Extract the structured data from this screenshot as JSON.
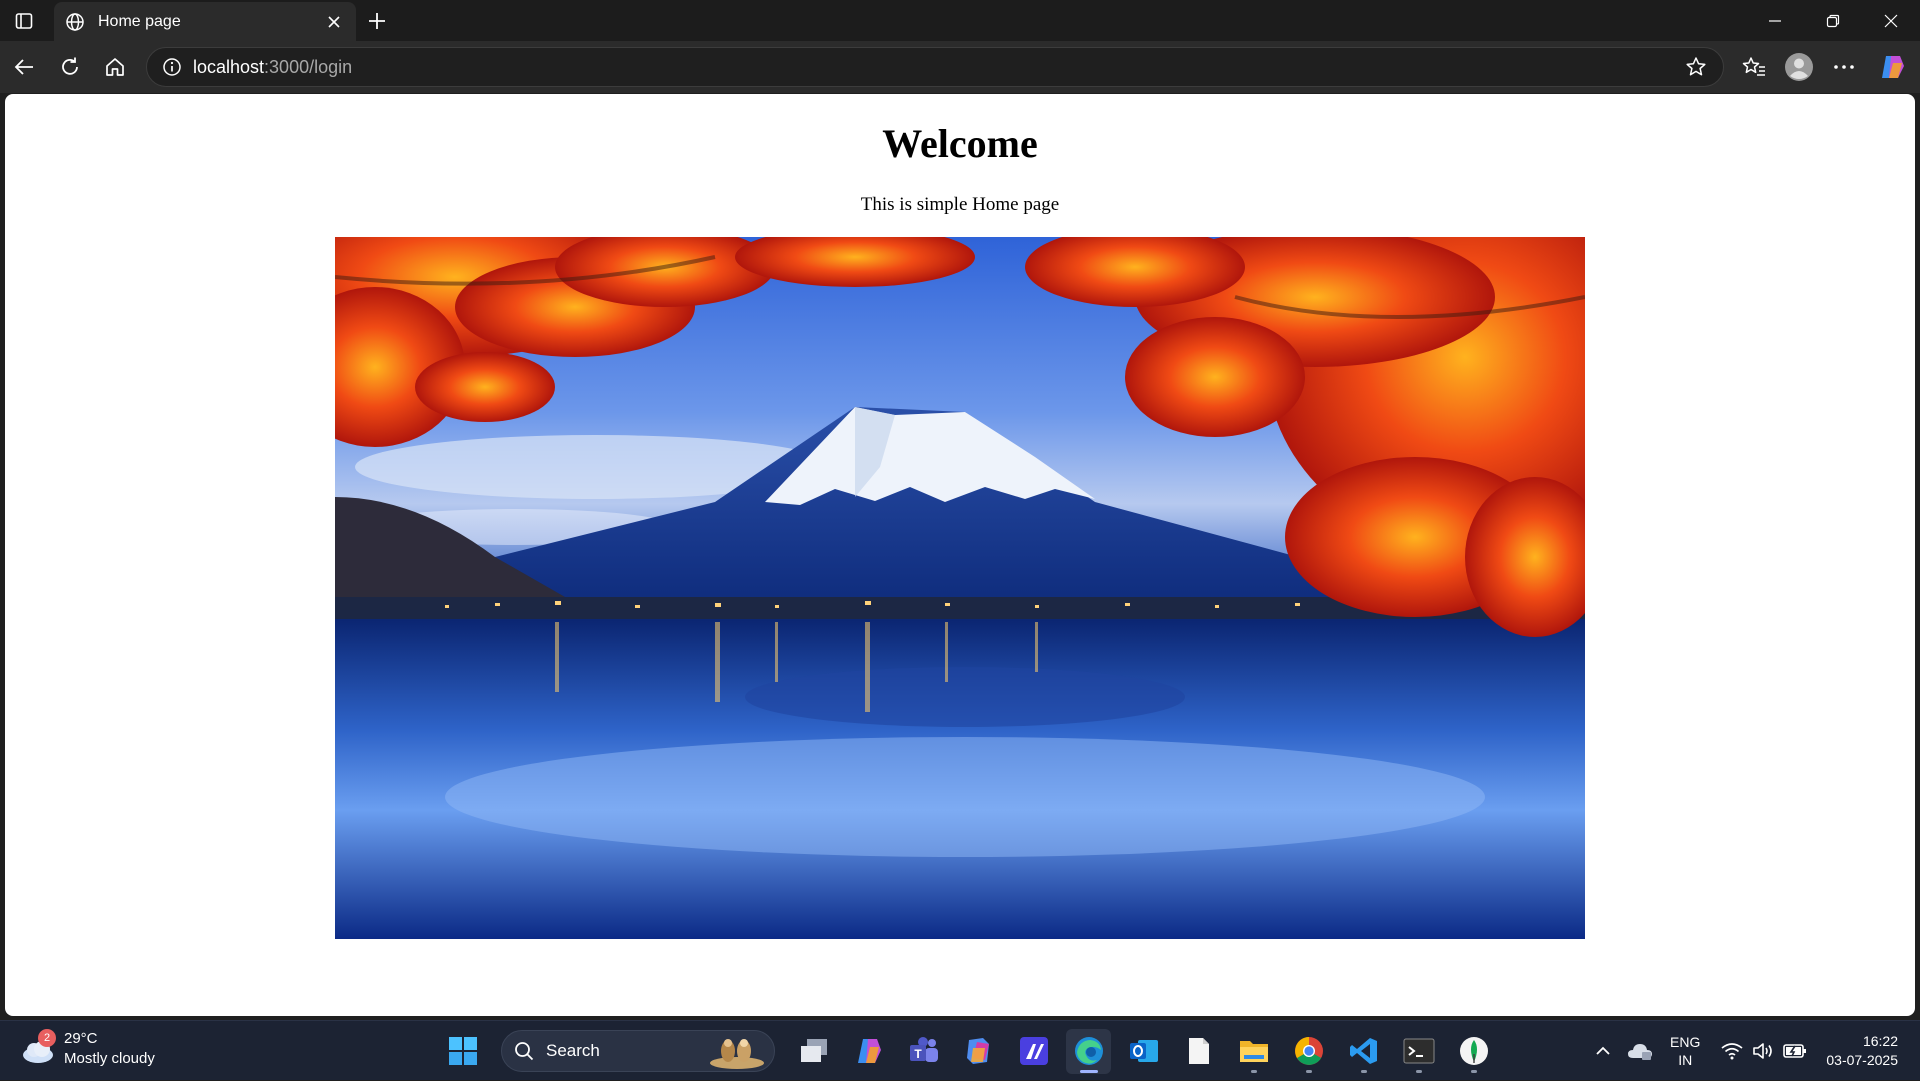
{
  "browser": {
    "tab_title": "Home page",
    "url_host": "localhost",
    "url_path": ":3000/login"
  },
  "page": {
    "heading": "Welcome",
    "text": "This is simple Home page",
    "image_alt": "Mount Fuji with red autumn maple leaves reflected in a lake"
  },
  "taskbar": {
    "weather_badge": "2",
    "weather_temp": "29°C",
    "weather_desc": "Mostly cloudy",
    "search_label": "Search",
    "lang_line1": "ENG",
    "lang_line2": "IN",
    "time": "16:22",
    "date": "03-07-2025"
  },
  "icons": {
    "app_icons": [
      "task-view-icon",
      "copilot-icon",
      "teams-icon",
      "m365-icon",
      "app-icon",
      "edge-icon",
      "outlook-icon",
      "notepad-icon",
      "file-explorer-icon",
      "chrome-icon",
      "vscode-icon",
      "terminal-icon",
      "mongodb-compass-icon"
    ]
  },
  "colors": {
    "accent": "#9fb4ff",
    "titlebar": "#1c1c1c",
    "toolbar": "#2b2b2b",
    "taskbar": "#1c2333"
  }
}
